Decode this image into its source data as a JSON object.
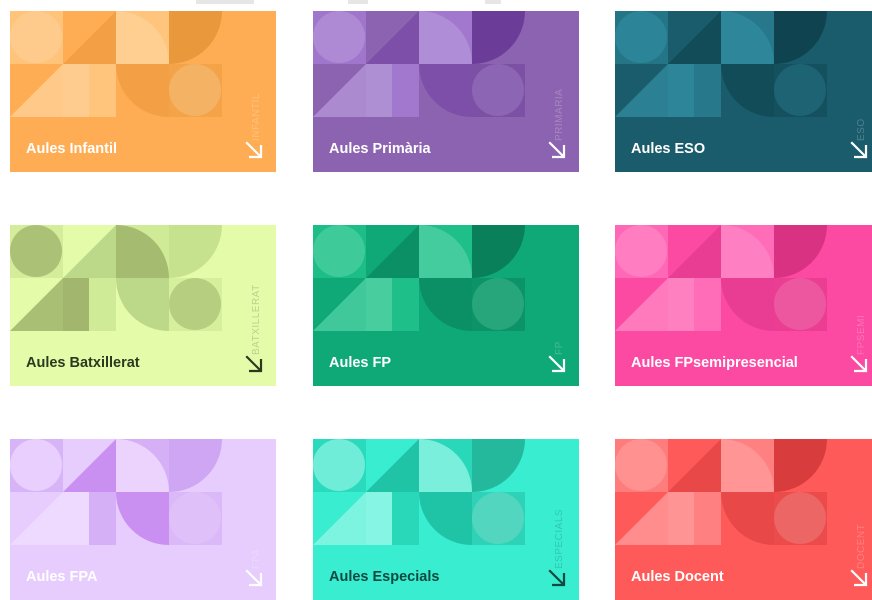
{
  "cards": [
    {
      "title": "Aules Infantil",
      "side_label": "INFANTIL",
      "arrow_icon": "arrow-down-right-icon",
      "bg": "#ffad54",
      "text_color": "#ffffff",
      "shades": [
        "#ffc57d",
        "#f39f45",
        "#ffcf96",
        "#e9993b"
      ]
    },
    {
      "title": "Aules Primària",
      "side_label": "PRIMARIA",
      "arrow_icon": "arrow-down-right-icon",
      "bg": "#8c63b0",
      "text_color": "#ffffff",
      "shades": [
        "#a278cf",
        "#7d4fa8",
        "#b393d8",
        "#6b3d98"
      ]
    },
    {
      "title": "Aules ESO",
      "side_label": "ESO",
      "arrow_icon": "arrow-down-right-icon",
      "bg": "#1a5c6c",
      "text_color": "#ffffff",
      "shades": [
        "#26788a",
        "#124c59",
        "#2f8a9e",
        "#0f4350"
      ]
    },
    {
      "title": "Aules Batxillerat",
      "side_label": "BATXILLERAT",
      "arrow_icon": "arrow-down-right-icon",
      "bg": "#e4fcaa",
      "text_color": "#2a3a1e",
      "shades": [
        "#d0eb98",
        "#bcd98a",
        "#9aaf66",
        "#c7e28f"
      ]
    },
    {
      "title": "Aules FP",
      "side_label": "FP",
      "arrow_icon": "arrow-down-right-icon",
      "bg": "#0ea977",
      "text_color": "#ffffff",
      "shades": [
        "#1fbf8a",
        "#0b8f64",
        "#4fd0a2",
        "#098059"
      ]
    },
    {
      "title": "Aules FPsemipresencial",
      "side_label": "FPSEMI",
      "arrow_icon": "arrow-down-right-icon",
      "bg": "#fc4aa2",
      "text_color": "#ffffff",
      "shades": [
        "#ff6cb8",
        "#e83d92",
        "#ff86c4",
        "#d93282"
      ]
    },
    {
      "title": "Aules FPA",
      "side_label": "FPA",
      "arrow_icon": "arrow-down-right-icon",
      "bg": "#e6cdfd",
      "text_color": "#ffffff",
      "shades": [
        "#d5b0f7",
        "#c990f2",
        "#f0dcff",
        "#cfa6f4"
      ]
    },
    {
      "title": "Aules Especials",
      "side_label": "ESPECIALS",
      "arrow_icon": "arrow-down-right-icon",
      "bg": "#38edd0",
      "text_color": "#0f4a40",
      "shades": [
        "#29d7b9",
        "#1fc3a6",
        "#8ff5e4",
        "#24b89d"
      ]
    },
    {
      "title": "Aules Docent",
      "side_label": "DOCENT",
      "arrow_icon": "arrow-down-right-icon",
      "bg": "#ff5a5a",
      "text_color": "#ffffff",
      "shades": [
        "#ff8080",
        "#e84848",
        "#ff9a9a",
        "#d93c3c"
      ]
    }
  ]
}
